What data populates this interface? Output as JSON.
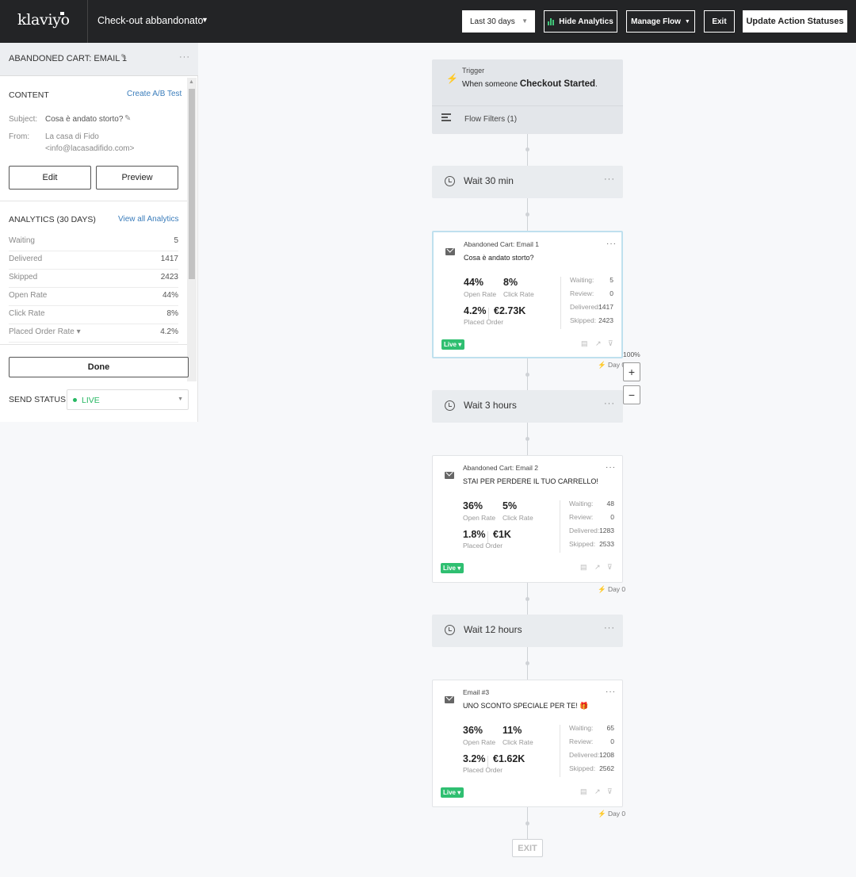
{
  "topbar": {
    "logo": "klaviyo",
    "flow_name": "Check-out abbandonato",
    "date_range": "Last 30 days",
    "hide_analytics": "Hide Analytics",
    "manage_flow": "Manage Flow",
    "exit": "Exit",
    "update_statuses": "Update Action Statuses"
  },
  "sidebar": {
    "title": "ABANDONED CART: EMAIL 1",
    "content_heading": "CONTENT",
    "create_ab": "Create A/B Test",
    "subject_label": "Subject:",
    "subject_value": "Cosa è andato storto?",
    "from_label": "From:",
    "from_name": "La casa di Fido",
    "from_email": "<info@lacasadifido.com>",
    "edit": "Edit",
    "preview": "Preview",
    "analytics_heading": "ANALYTICS (30 DAYS)",
    "view_all": "View all Analytics",
    "analytics": [
      {
        "label": "Waiting",
        "value": "5"
      },
      {
        "label": "Delivered",
        "value": "1417"
      },
      {
        "label": "Skipped",
        "value": "2423"
      },
      {
        "label": "Open Rate",
        "value": "44%"
      },
      {
        "label": "Click Rate",
        "value": "8%"
      },
      {
        "label": "Placed Order Rate ▾",
        "value": "4.2%"
      }
    ],
    "done": "Done",
    "send_status_label": "SEND STATUS",
    "send_status_value": "LIVE"
  },
  "canvas": {
    "trigger": {
      "label": "Trigger",
      "prefix": "When someone",
      "event": "Checkout Started",
      "suffix": ".",
      "filters": "Flow Filters (1)"
    },
    "waits": [
      "Wait 30 min",
      "Wait 3 hours",
      "Wait 12 hours"
    ],
    "wait_dots": "···",
    "cards": [
      {
        "name": "Abandoned Cart: Email 1",
        "subject": "Cosa è andato storto?",
        "open_rate": "44%",
        "open_label": "Open Rate",
        "click_rate": "8%",
        "click_label": "Click Rate",
        "placed_rate": "4.2%",
        "revenue": "€2.73K",
        "placed_label": "Placed Order",
        "stats": [
          {
            "k": "Waiting:",
            "v": "5"
          },
          {
            "k": "Review:",
            "v": "0"
          },
          {
            "k": "Delivered:",
            "v": "1417"
          },
          {
            "k": "Skipped:",
            "v": "2423"
          }
        ],
        "status": "Live ▾"
      },
      {
        "name": "Abandoned Cart: Email 2",
        "subject": "STAI PER PERDERE IL TUO CARRELLO!",
        "open_rate": "36%",
        "open_label": "Open Rate",
        "click_rate": "5%",
        "click_label": "Click Rate",
        "placed_rate": "1.8%",
        "revenue": "€1K",
        "placed_label": "Placed Order",
        "stats": [
          {
            "k": "Waiting:",
            "v": "48"
          },
          {
            "k": "Review:",
            "v": "0"
          },
          {
            "k": "Delivered:",
            "v": "1283"
          },
          {
            "k": "Skipped:",
            "v": "2533"
          }
        ],
        "status": "Live ▾"
      },
      {
        "name": "Email #3",
        "subject": "UNO SCONTO SPECIALE PER TE! 🎁",
        "open_rate": "36%",
        "open_label": "Open Rate",
        "click_rate": "11%",
        "click_label": "Click Rate",
        "placed_rate": "3.2%",
        "revenue": "€1.62K",
        "placed_label": "Placed Order",
        "stats": [
          {
            "k": "Waiting:",
            "v": "65"
          },
          {
            "k": "Review:",
            "v": "0"
          },
          {
            "k": "Delivered:",
            "v": "1208"
          },
          {
            "k": "Skipped:",
            "v": "2562"
          }
        ],
        "status": "Live ▾"
      }
    ],
    "day_label": "⚡ Day 0",
    "zoom": "100%",
    "zoom_in": "+",
    "zoom_out": "−",
    "exit": "EXIT"
  },
  "colors": {
    "topbar": "#232426",
    "live_green": "#2fbf71",
    "link_blue": "#3b7dbb"
  }
}
